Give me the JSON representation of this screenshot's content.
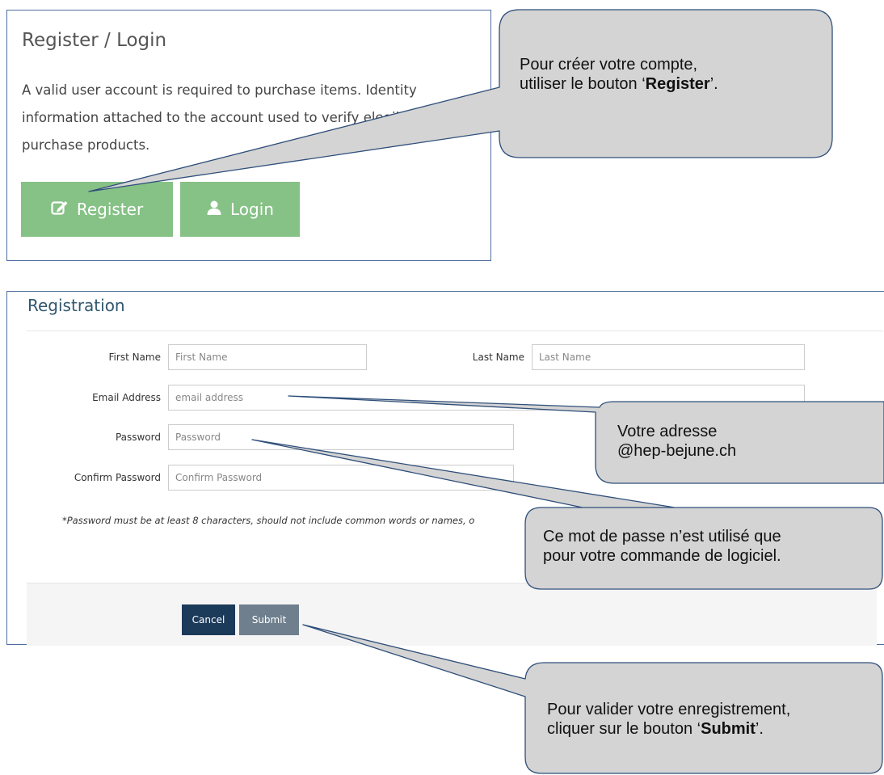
{
  "top_strip_text": "",
  "login_panel": {
    "title": "Register / Login",
    "description": "A valid user account is required to purchase items. Identity information attached to the account used to verify elegibility to purchase products.",
    "register_label": "Register",
    "login_label": "Login"
  },
  "registration": {
    "title": "Registration",
    "first_name_label": "First Name",
    "first_name_placeholder": "First Name",
    "last_name_label": "Last Name",
    "last_name_placeholder": "Last Name",
    "email_label": "Email Address",
    "email_placeholder": "email address",
    "password_label": "Password",
    "password_placeholder": "Password",
    "confirm_label": "Confirm Password",
    "confirm_placeholder": "Confirm Password",
    "password_note": "*Password must be at least 8 characters, should not include common words or names, o",
    "cancel_label": "Cancel",
    "submit_label": "Submit"
  },
  "callouts": {
    "register": {
      "line1": "Pour créer votre compte,",
      "line2_pre": "utiliser le bouton ‘",
      "line2_bold": "Register",
      "line2_post": "’."
    },
    "email": {
      "line1": "Votre adresse",
      "line2": "@hep-bejune.ch"
    },
    "password": {
      "line1": "Ce mot de passe n’est utilisé que",
      "line2": "pour votre commande de logiciel."
    },
    "submit": {
      "line1": "Pour valider votre enregistrement,",
      "line2_pre": "cliquer sur le bouton ‘",
      "line2_bold": "Submit",
      "line2_post": "’."
    }
  },
  "colors": {
    "accent_green": "#86c186",
    "panel_border": "#4f6ea0",
    "callout_fill": "#d4d4d4",
    "callout_stroke": "#2f4f7a",
    "cancel_button": "#1c3a5a",
    "submit_button": "#6f7f8e"
  },
  "icons": {
    "register": "edit-icon",
    "login": "user-icon"
  }
}
